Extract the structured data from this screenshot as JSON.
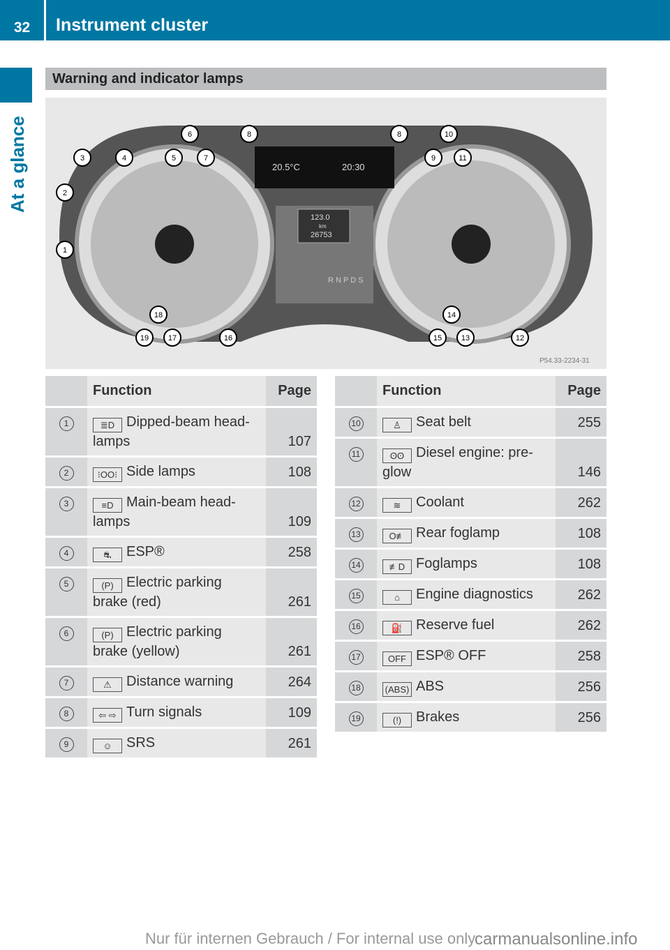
{
  "header": {
    "page_number": "32",
    "title": "Instrument cluster",
    "side_tab": "At a glance"
  },
  "section_title": "Warning and indicator lamps",
  "figure": {
    "outside_temp": "20.5°C",
    "clock": "20:30",
    "trip": "123.0",
    "trip_unit": "km",
    "odometer": "26753",
    "gears": "R N P D S",
    "reference": "P54.33-2234-31",
    "callouts": [
      "1",
      "2",
      "3",
      "4",
      "5",
      "6",
      "7",
      "8",
      "8",
      "9",
      "10",
      "11",
      "12",
      "13",
      "14",
      "15",
      "16",
      "17",
      "18",
      "19"
    ]
  },
  "table_headers": {
    "function": "Function",
    "page": "Page"
  },
  "left_rows": [
    {
      "num": "1",
      "icon": "dipped-beam",
      "icon_glyph": "≣D",
      "label": "Dipped-beam head-lamps",
      "page": "107"
    },
    {
      "num": "2",
      "icon": "side-lamps",
      "icon_glyph": "⁝OO⁝",
      "label": "Side lamps",
      "page": "108"
    },
    {
      "num": "3",
      "icon": "main-beam",
      "icon_glyph": "≡D",
      "label": "Main-beam head-lamps",
      "page": "109"
    },
    {
      "num": "4",
      "icon": "esp",
      "icon_glyph": "⛐",
      "label": "ESP®",
      "page": "258"
    },
    {
      "num": "5",
      "icon": "parking-brake",
      "icon_glyph": "(P)",
      "label": "Electric parking brake (red)",
      "page": "261"
    },
    {
      "num": "6",
      "icon": "parking-brake",
      "icon_glyph": "(P)",
      "label": "Electric parking brake (yellow)",
      "page": "261"
    },
    {
      "num": "7",
      "icon": "distance-warning",
      "icon_glyph": "⚠",
      "label": "Distance warning",
      "page": "264"
    },
    {
      "num": "8",
      "icon": "turn-signals",
      "icon_glyph": "⇦ ⇨",
      "label": "Turn signals",
      "page": "109"
    },
    {
      "num": "9",
      "icon": "srs",
      "icon_glyph": "☺",
      "label": "SRS",
      "page": "261"
    }
  ],
  "right_rows": [
    {
      "num": "10",
      "icon": "seat-belt",
      "icon_glyph": "♙",
      "label": "Seat belt",
      "page": "255"
    },
    {
      "num": "11",
      "icon": "preglow",
      "icon_glyph": "ʘʘ",
      "label": "Diesel engine: pre-glow",
      "page": "146"
    },
    {
      "num": "12",
      "icon": "coolant",
      "icon_glyph": "≋",
      "label": "Coolant",
      "page": "262"
    },
    {
      "num": "13",
      "icon": "rear-foglamp",
      "icon_glyph": "O≢",
      "label": "Rear foglamp",
      "page": "108"
    },
    {
      "num": "14",
      "icon": "foglamps",
      "icon_glyph": "≢D",
      "label": "Foglamps",
      "page": "108"
    },
    {
      "num": "15",
      "icon": "engine-diagnostics",
      "icon_glyph": "⌂",
      "label": "Engine diagnostics",
      "page": "262"
    },
    {
      "num": "16",
      "icon": "reserve-fuel",
      "icon_glyph": "⛽",
      "label": "Reserve fuel",
      "page": "262"
    },
    {
      "num": "17",
      "icon": "esp-off",
      "icon_glyph": "OFF",
      "label": "ESP® OFF",
      "page": "258"
    },
    {
      "num": "18",
      "icon": "abs",
      "icon_glyph": "(ABS)",
      "label": "ABS",
      "page": "256"
    },
    {
      "num": "19",
      "icon": "brakes",
      "icon_glyph": "(!)",
      "label": "Brakes",
      "page": "256"
    }
  ],
  "footer": {
    "watermark": "Nur für internen Gebrauch / For internal use only",
    "site": "carmanualsonline.info"
  }
}
